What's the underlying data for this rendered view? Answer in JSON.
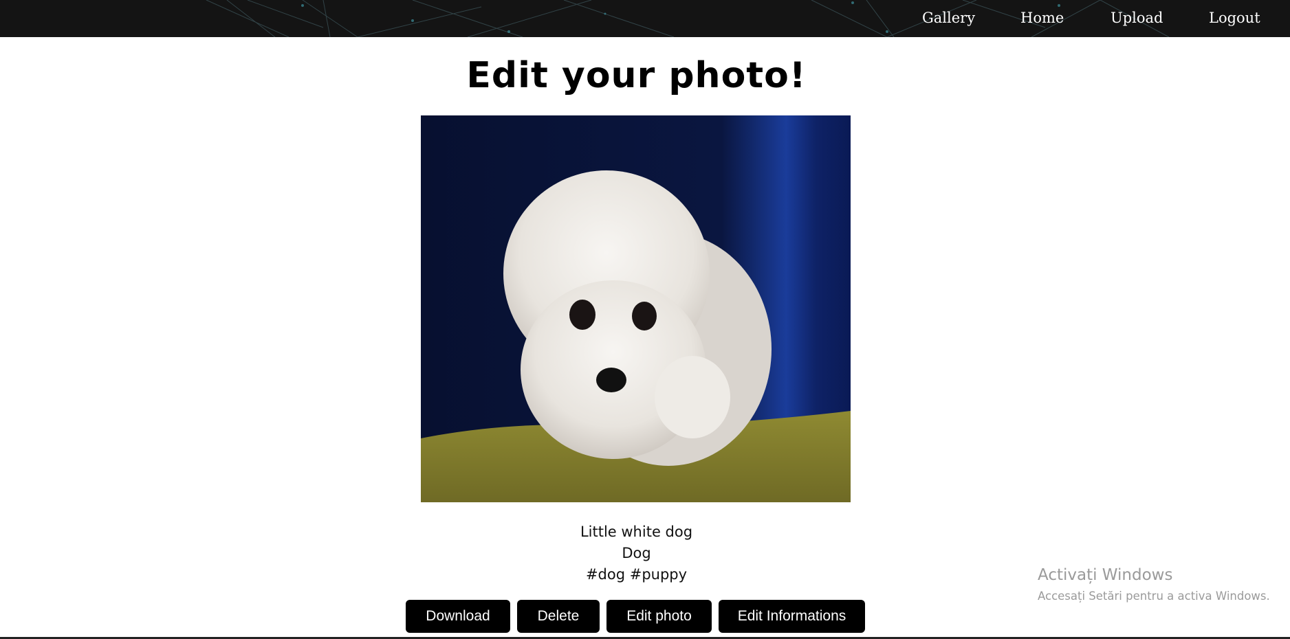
{
  "nav": {
    "links": [
      "Gallery",
      "Home",
      "Upload",
      "Logout"
    ]
  },
  "page": {
    "title": "Edit your photo!"
  },
  "photo": {
    "alt": "Little white dog",
    "title": "Little white dog",
    "category": "Dog",
    "tags": "#dog #puppy"
  },
  "actions": {
    "download": "Download",
    "delete": "Delete",
    "edit_photo": "Edit photo",
    "edit_info": "Edit Informations"
  },
  "os_watermark": {
    "title": "Activați Windows",
    "subtitle": "Accesați Setări pentru a activa Windows."
  }
}
